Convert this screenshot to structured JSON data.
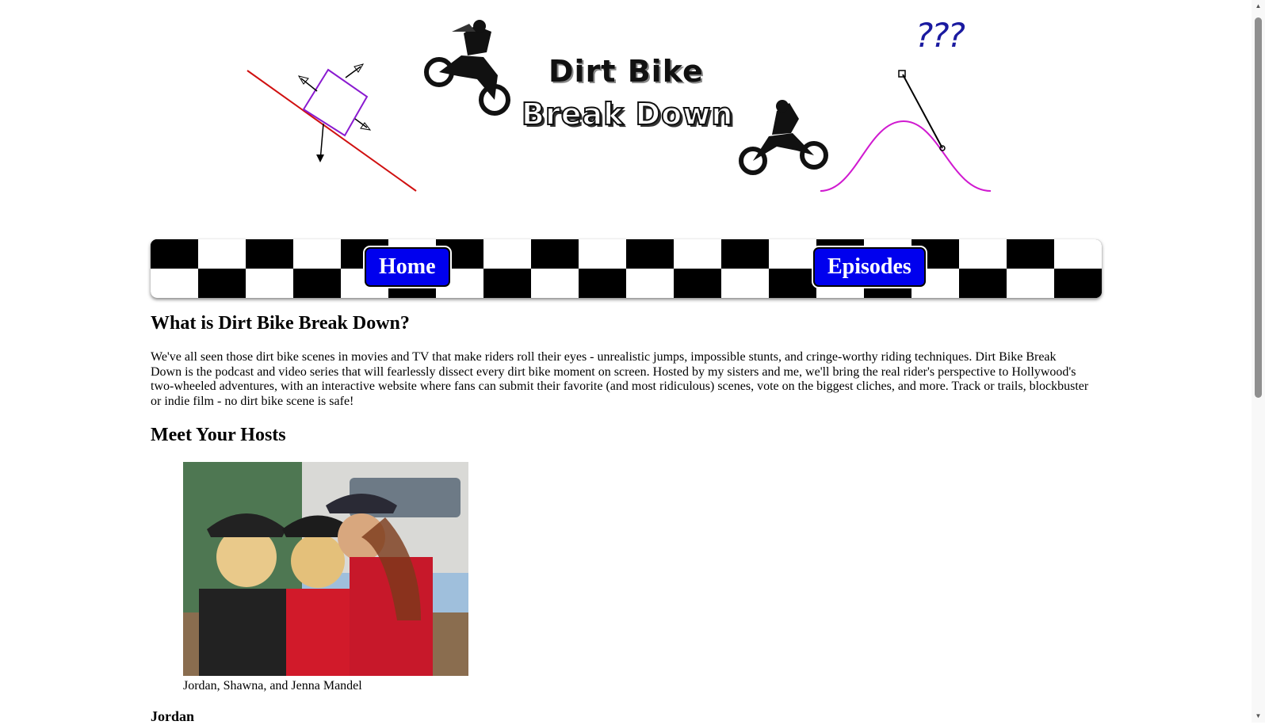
{
  "banner": {
    "logo_line1": "Dirt Bike",
    "logo_line2": "Break Down",
    "question_marks": "???"
  },
  "nav": {
    "home_label": "Home",
    "episodes_label": "Episodes",
    "button_color": "#0000ee"
  },
  "intro": {
    "heading": "What is Dirt Bike Break Down?",
    "body": "We've all seen those dirt bike scenes in movies and TV that make riders roll their eyes - unrealistic jumps, impossible stunts, and cringe-worthy riding techniques. Dirt Bike Break Down is the podcast and video series that will fearlessly dissect every dirt bike moment on screen. Hosted by my sisters and me, we'll bring the real rider's perspective to Hollywood's two-wheeled adventures, with an interactive website where fans can submit their favorite (and most ridiculous) scenes, vote on the biggest cliches, and more. Track or trails, blockbuster or indie film - no dirt bike scene is safe!"
  },
  "hosts": {
    "heading": "Meet Your Hosts",
    "photo_caption": "Jordan, Shawna, and Jenna Mandel",
    "first_host_name": "Jordan"
  },
  "icons": {
    "scroll_up": "scroll-up-arrow-icon",
    "scroll_down": "scroll-down-arrow-icon"
  }
}
